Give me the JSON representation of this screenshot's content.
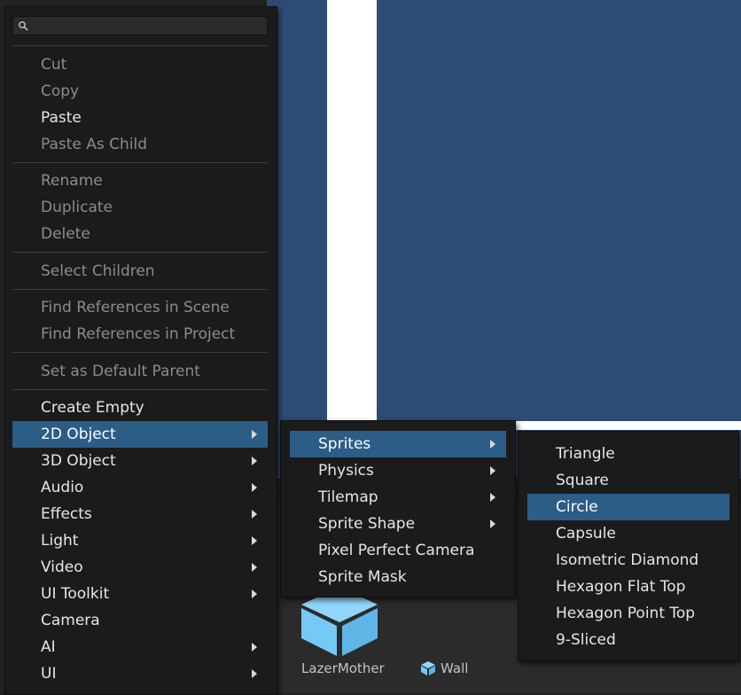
{
  "search": {
    "placeholder": ""
  },
  "main_menu": {
    "items": [
      {
        "label": "Cut",
        "enabled": false
      },
      {
        "label": "Copy",
        "enabled": false
      },
      {
        "label": "Paste",
        "enabled": true
      },
      {
        "label": "Paste As Child",
        "enabled": false
      },
      {
        "label": "Rename",
        "enabled": false
      },
      {
        "label": "Duplicate",
        "enabled": false
      },
      {
        "label": "Delete",
        "enabled": false
      },
      {
        "label": "Select Children",
        "enabled": false
      },
      {
        "label": "Find References in Scene",
        "enabled": false
      },
      {
        "label": "Find References in Project",
        "enabled": false
      },
      {
        "label": "Set as Default Parent",
        "enabled": false
      },
      {
        "label": "Create Empty",
        "enabled": true
      },
      {
        "label": "2D Object",
        "enabled": true,
        "submenu": true,
        "highlighted": true
      },
      {
        "label": "3D Object",
        "enabled": true,
        "submenu": true
      },
      {
        "label": "Audio",
        "enabled": true,
        "submenu": true
      },
      {
        "label": "Effects",
        "enabled": true,
        "submenu": true
      },
      {
        "label": "Light",
        "enabled": true,
        "submenu": true
      },
      {
        "label": "Video",
        "enabled": true,
        "submenu": true
      },
      {
        "label": "UI Toolkit",
        "enabled": true,
        "submenu": true
      },
      {
        "label": "Camera",
        "enabled": true
      },
      {
        "label": "AI",
        "enabled": true,
        "submenu": true
      },
      {
        "label": "UI",
        "enabled": true,
        "submenu": true
      }
    ]
  },
  "submenu_2d": {
    "items": [
      {
        "label": "Sprites",
        "submenu": true,
        "highlighted": true
      },
      {
        "label": "Physics",
        "submenu": true
      },
      {
        "label": "Tilemap",
        "submenu": true
      },
      {
        "label": "Sprite Shape",
        "submenu": true
      },
      {
        "label": "Pixel Perfect Camera"
      },
      {
        "label": "Sprite Mask"
      }
    ]
  },
  "submenu_sprites": {
    "items": [
      {
        "label": "Triangle"
      },
      {
        "label": "Square"
      },
      {
        "label": "Circle",
        "highlighted": true
      },
      {
        "label": "Capsule"
      },
      {
        "label": "Isometric Diamond"
      },
      {
        "label": "Hexagon Flat Top"
      },
      {
        "label": "Hexagon Point Top"
      },
      {
        "label": "9-Sliced"
      }
    ]
  },
  "project_assets": [
    {
      "name": "LazerMother",
      "icon": "cube-icon"
    },
    {
      "name": "Wall",
      "icon": "cube-icon"
    }
  ],
  "colors": {
    "highlight": "#2c5d87",
    "scene_background": "#2d4b75",
    "asset_icon": "#74c9f5"
  }
}
